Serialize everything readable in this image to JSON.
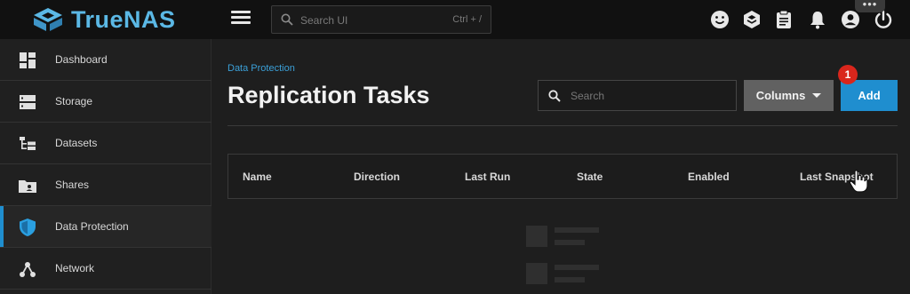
{
  "app": {
    "brand": "TrueNAS",
    "search_placeholder": "Search UI",
    "search_shortcut": "Ctrl + /",
    "top_icons": [
      "feedback-smiley-icon",
      "truecommand-icon",
      "clipboard-jobs-icon",
      "bell-notifications-icon",
      "account-circle-icon",
      "power-icon"
    ]
  },
  "sidebar": {
    "items": [
      {
        "label": "Dashboard",
        "icon": "dashboard-icon"
      },
      {
        "label": "Storage",
        "icon": "storage-icon"
      },
      {
        "label": "Datasets",
        "icon": "datasets-icon"
      },
      {
        "label": "Shares",
        "icon": "shares-folder-icon"
      },
      {
        "label": "Data Protection",
        "icon": "shield-icon",
        "active": true
      },
      {
        "label": "Network",
        "icon": "network-icon"
      }
    ]
  },
  "page": {
    "breadcrumb": "Data Protection",
    "title": "Replication Tasks",
    "search_placeholder": "Search",
    "columns_label": "Columns",
    "add_label": "Add",
    "badge": "1",
    "columns": [
      "Name",
      "Direction",
      "Last Run",
      "State",
      "Enabled",
      "Last Snapshot"
    ]
  },
  "colors": {
    "accent": "#1f8ecf",
    "brand": "#5bb8e5",
    "badge": "#d9261c",
    "topbar": "#111111",
    "background": "#1e1e1e"
  }
}
